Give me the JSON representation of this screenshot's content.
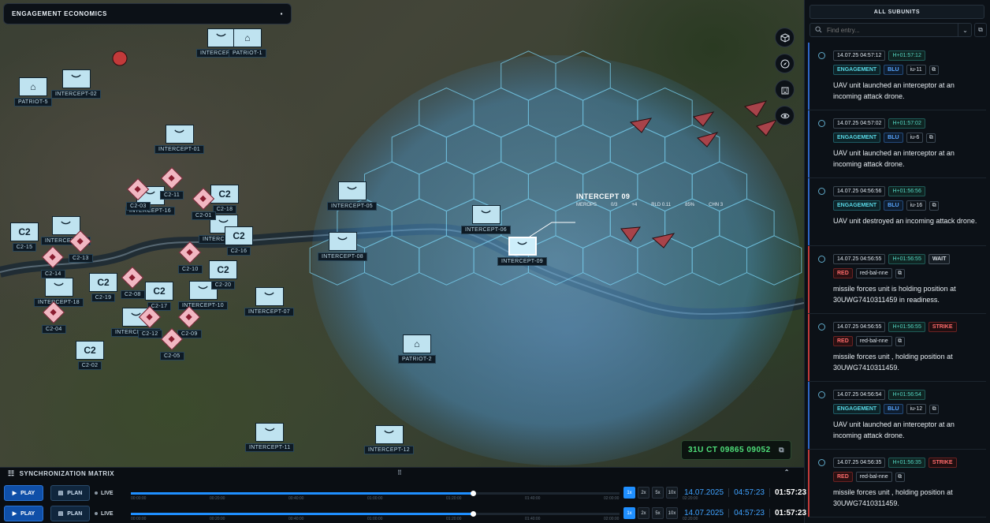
{
  "map": {
    "panel_title": "ENGAGEMENT ECONOMICS",
    "panel_toggle": "▪",
    "coordinate_readout": "31U CT 09865 09052",
    "selected": {
      "name": "INTERCEPT-09",
      "callout": "INTERCEPT 09",
      "stats": [
        "MEROPS",
        "0/3",
        "+4",
        "RLD 0.11",
        "85%",
        "CHN 3"
      ]
    },
    "units": {
      "friendly": [
        "INTERCEPT-03",
        "PATRIOT-1",
        "PATRIOT-5",
        "INTERCEPT-02",
        "INTERCEPT-01",
        "INTERCEPT-05",
        "INTERCEPT-06",
        "INTERCEPT-08",
        "INTERCEPT-09",
        "INTERCEPT-07",
        "INTERCEPT-10",
        "INTERCEPT-11",
        "INTERCEPT-12",
        "INTERCEPT-13",
        "INTERCEPT-16",
        "INTERCEPT-17",
        "INTERCEPT-18",
        "INTERCEPT-04",
        "PATRIOT-2"
      ],
      "c2": [
        "C2-18",
        "C2-15",
        "C2-16",
        "C2-19",
        "C2-20",
        "C2-17",
        "C2-02"
      ],
      "c2_box_text": "C2",
      "c2_hostile": [
        "C2-03",
        "C2-11",
        "C2-01",
        "C2-14",
        "C2-13",
        "C2-10",
        "C2-04",
        "C2-08",
        "C2-09",
        "C2-05",
        "C2-12"
      ]
    }
  },
  "side": {
    "header": "ALL SUBUNITS",
    "search_placeholder": "Find entry...",
    "entries": [
      {
        "time": "14.07.25 04:57:12",
        "hplus": "H+01:57:12",
        "type": "ENGAGEMENT",
        "side": "BLU",
        "unit": "iu-11",
        "text": "UAV unit launched an interceptor at an incoming attack drone.",
        "rail_color": "#2e66c7",
        "status": ""
      },
      {
        "time": "14.07.25 04:57:02",
        "hplus": "H+01:57:02",
        "type": "ENGAGEMENT",
        "side": "BLU",
        "unit": "iu-6",
        "text": "UAV unit launched an interceptor at an incoming attack drone.",
        "rail_color": "#2e66c7",
        "status": ""
      },
      {
        "time": "14.07.25 04:56:56",
        "hplus": "H+01:56:56",
        "type": "ENGAGEMENT",
        "side": "BLU",
        "unit": "iu-16",
        "text": "UAV unit destroyed an incoming attack drone.",
        "rail_color": "#2e66c7",
        "status": ""
      },
      {
        "time": "14.07.25 04:56:55",
        "hplus": "H+01:56:55",
        "type": "",
        "side": "RED",
        "unit": "red-bal-nne",
        "text": "missile forces unit is holding position at 30UWG7410311459 in readiness.",
        "rail_color": "#c23a3a",
        "status": "WAIT"
      },
      {
        "time": "14.07.25 04:56:55",
        "hplus": "H+01:56:55",
        "type": "",
        "side": "RED",
        "unit": "red-bal-nne",
        "text": "missile forces unit , holding position at 30UWG7410311459.",
        "rail_color": "#c23a3a",
        "status": "STRIKE"
      },
      {
        "time": "14.07.25 04:56:54",
        "hplus": "H+01:56:54",
        "type": "ENGAGEMENT",
        "side": "BLU",
        "unit": "iu-12",
        "text": "UAV unit launched an interceptor at an incoming attack drone.",
        "rail_color": "#2e66c7",
        "status": ""
      },
      {
        "time": "14.07.25 04:56:35",
        "hplus": "H+01:56:35",
        "type": "",
        "side": "RED",
        "unit": "red-bal-nne",
        "text": "missile forces unit , holding position at 30UWG7410311459.",
        "rail_color": "#c23a3a",
        "status": "STRIKE"
      }
    ]
  },
  "timeline": {
    "title": "SYNCHRONIZATION MATRIX",
    "rows": [
      {
        "play": "PLAY",
        "plan": "PLAN",
        "live": "LIVE",
        "progress": 0.7,
        "date": "14.07.2025",
        "time": "04:57:23",
        "elapsed": "01:57:23"
      },
      {
        "play": "PLAY",
        "plan": "PLAN",
        "live": "LIVE",
        "progress": 0.7,
        "date": "14.07.2025",
        "time": "04:57:23",
        "elapsed": "01:57:23"
      }
    ],
    "speeds": [
      "1x",
      "2x",
      "5x",
      "10x"
    ],
    "active_speed": "1x",
    "ticks": [
      "00:00:00",
      "00:20:00",
      "00:40:00",
      "01:00:00",
      "01:20:00",
      "01:40:00",
      "02:00:00",
      "02:20:00"
    ]
  },
  "colors": {
    "accent": "#1f8fff",
    "coordinate": "#4fe07a",
    "hostile": "#c23a3a",
    "friendly": "#bfe3f0"
  }
}
